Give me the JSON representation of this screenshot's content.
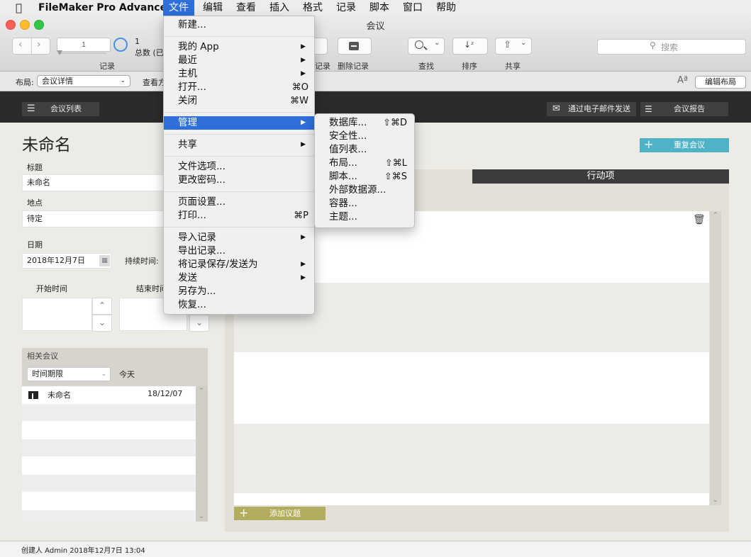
{
  "menubar": {
    "apple_icon": "apple-logo",
    "app_name": "FileMaker Pro Advanced",
    "items": [
      "文件",
      "编辑",
      "查看",
      "插入",
      "格式",
      "记录",
      "脚本",
      "窗口",
      "帮助"
    ]
  },
  "window": {
    "title": "会议"
  },
  "toolbar": {
    "record_current": "1",
    "record_count": "1",
    "record_total_text": "总数 (已",
    "record_label": "记录",
    "new_record_label_partial": "记录",
    "delete_record_label": "删除记录",
    "find_label": "查找",
    "sort_label": "排序",
    "share_label": "共享",
    "search_placeholder": "搜索"
  },
  "layoutbar": {
    "layout_label": "布局:",
    "layout_value": "会议详情",
    "view_as_partial": "查看方",
    "text_size_icon": "Aª",
    "edit_layout": "编辑布局"
  },
  "header": {
    "meeting_list": "会议列表",
    "send_email": "通过电子邮件发送",
    "meeting_report": "会议报告"
  },
  "record": {
    "title_display": "未命名",
    "repeat_meeting": "重复会议",
    "title_label": "标题",
    "title_value": "未命名",
    "location_label": "地点",
    "location_value": "待定",
    "date_label": "日期",
    "date_value": "2018年12月7日",
    "duration_label": "持续时间:",
    "start_label": "开始时间",
    "end_label": "结束时间",
    "action_items_header": "行动项",
    "add_agenda": "添加议题"
  },
  "related": {
    "header": "相关会议",
    "filter_value": "时间期限",
    "filter_today": "今天",
    "rows": [
      {
        "name": "未命名",
        "date": "18/12/07"
      }
    ]
  },
  "status": {
    "created_by": "创建人 Admin 2018年12月7日  13:04"
  },
  "file_menu": {
    "items": [
      {
        "label": "新建...",
        "shortcut": ""
      },
      {
        "label": "我的 App",
        "submenu": true
      },
      {
        "label": "最近",
        "submenu": true
      },
      {
        "label": "主机",
        "submenu": true
      },
      {
        "label": "打开...",
        "shortcut": "⌘O"
      },
      {
        "label": "关闭",
        "shortcut": "⌘W"
      },
      {
        "label": "管理",
        "submenu": true,
        "highlighted": true
      },
      {
        "label": "共享",
        "submenu": true
      },
      {
        "label": "文件选项...",
        "shortcut": ""
      },
      {
        "label": "更改密码...",
        "shortcut": ""
      },
      {
        "label": "页面设置...",
        "shortcut": ""
      },
      {
        "label": "打印...",
        "shortcut": "⌘P"
      },
      {
        "label": "导入记录",
        "submenu": true
      },
      {
        "label": "导出记录...",
        "shortcut": ""
      },
      {
        "label": "将记录保存/发送为",
        "submenu": true
      },
      {
        "label": "发送",
        "submenu": true
      },
      {
        "label": "另存为...",
        "shortcut": ""
      },
      {
        "label": "恢复...",
        "shortcut": ""
      }
    ]
  },
  "manage_submenu": {
    "items": [
      {
        "label": "数据库...",
        "shortcut": "⇧⌘D"
      },
      {
        "label": "安全性...",
        "shortcut": ""
      },
      {
        "label": "值列表...",
        "shortcut": ""
      },
      {
        "label": "布局...",
        "shortcut": "⇧⌘L"
      },
      {
        "label": "脚本...",
        "shortcut": "⇧⌘S"
      },
      {
        "label": "外部数据源...",
        "shortcut": ""
      },
      {
        "label": "容器...",
        "shortcut": ""
      },
      {
        "label": "主题...",
        "shortcut": ""
      }
    ]
  },
  "colors": {
    "accent_teal": "#4fb3c7",
    "add_olive": "#b2ad5e",
    "menu_highlight": "#2e6fd9"
  }
}
